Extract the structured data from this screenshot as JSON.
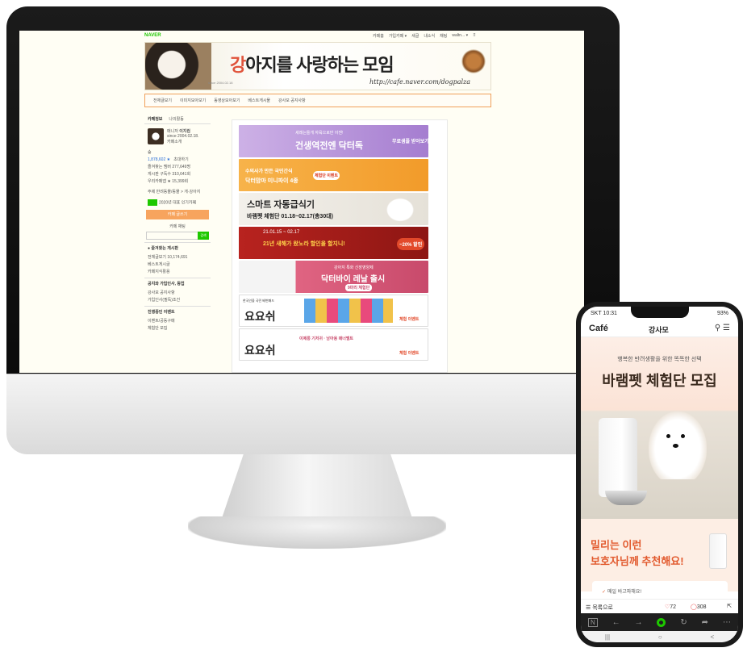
{
  "desktop": {
    "naver_logo": "NAVER",
    "top_links": [
      "카페홈",
      "가입카페 ▾",
      "새글",
      "내소식",
      "채팅",
      "waltn... ▾",
      "⠿"
    ],
    "banner": {
      "title_a": "강",
      "title_b": "아지를 ",
      "title_c": "사랑",
      "title_d": "하는 ",
      "title_e": "모임",
      "url": "http://cafe.naver.com/dogpalza",
      "since": "since 2004.02.18"
    },
    "menu": [
      "전체글보기",
      "이미지모아보기",
      "동영상모아보기",
      "베스트게시물",
      "강사모 공지사항"
    ],
    "sidebar": {
      "tabs": [
        "카페정보",
        "나의활동"
      ],
      "manager_label": "매니저",
      "manager_name": "이지컴",
      "since": "since 2004.02.18.",
      "cafe_intro": "카페소개",
      "grade": "숲",
      "members": "1,878,602 ★",
      "invite": "초대하기",
      "stats": [
        "즐겨찾는 멤버 277,649명",
        "게시판 구독수 310,641회",
        "우리카페앱 ★ 15,399회"
      ],
      "category": "주제 반려동물/동물 > 개·강아지",
      "award": "2020년 대표 인기카페",
      "join_button": "카페 글쓰기",
      "chat": "카페 채팅",
      "search_button": "검색",
      "fav_head": "● 즐겨찾는 게시판",
      "boards": [
        "전체글보기 10,174,691",
        "베스트게시글",
        "카페지식활용"
      ],
      "notice_head": "공지와 가입인사, 등업",
      "notice_items": [
        "강사모 공지사항",
        "가입인사(필독)조건"
      ],
      "event_head": "진행중인 이벤트",
      "event_items": [
        "이벤트/공동구매",
        "체험단 모집"
      ]
    },
    "ads": [
      {
        "text": "건생역전엔 닥터독",
        "sub": "세레는들개 자육으로만 이젠!",
        "cta": "무료샘플 받아보기",
        "bg": "#b18bd0"
      },
      {
        "text": "닥터맘마 미니파이 4종",
        "sub": "수의사가 만든 국민간식",
        "cta": "체험단 이벤트",
        "bg": "#f5a733"
      },
      {
        "text": "스마트 자동급식기",
        "sub": "바램펫 체험단 01.18~02.17(총30대)",
        "cta": "",
        "bg": "#efece6"
      },
      {
        "text": "21년 새해가 왔노라 할인을 할지니!",
        "sub": "21.01.15 ~ 02.17",
        "cta": "~20% 할인",
        "bg": "#b7231f"
      },
      {
        "text": "닥터바이 레날 출시",
        "sub": "강아지 특화 신장영양제",
        "cta": "9마리 체험단",
        "bg": "#d8587a"
      },
      {
        "text": "요요쉬",
        "sub": "한국인을 국민 배변패드",
        "cta": "체험 이벤트",
        "bg": "#ffffff"
      },
      {
        "text": "요요쉬",
        "sub": "이제롱 기저귀 · 남아용 매너벨트",
        "cta": "체험 이벤트",
        "bg": "#ffffff"
      }
    ]
  },
  "phone": {
    "status_time": "SKT 10:31",
    "status_right": "93%",
    "logo": "Café",
    "title": "강사모",
    "hero_sub": "행복한 반려생활을 위한 똑똑한 선택",
    "hero_title": "바램펫 체험단 모집",
    "promo_line1": "밀리는 이런",
    "promo_line2": "보호자님께 추천해요!",
    "card_line": "매일 바고파해요!",
    "list_label": "목록으로",
    "likes": "72",
    "comments": "308",
    "colors": {
      "accent": "#e25a2e",
      "naver_green": "#1ec800"
    }
  }
}
